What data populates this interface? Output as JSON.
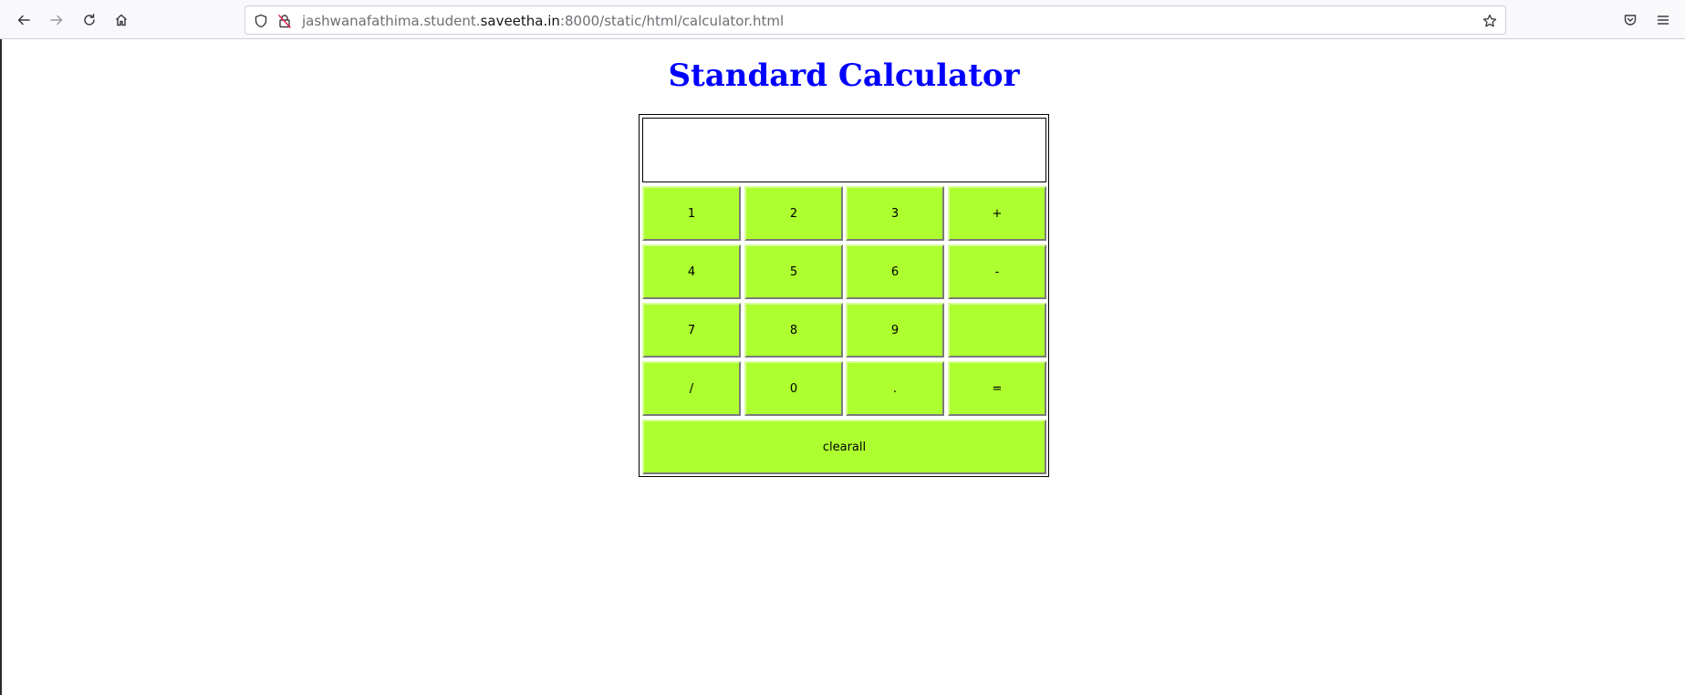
{
  "browser": {
    "url_prefix": "jashwanafathima.student.",
    "url_domain": "saveetha.in",
    "url_suffix": ":8000/static/html/calculator.html",
    "icons": [
      "back-arrow-icon",
      "forward-arrow-icon",
      "reload-icon",
      "home-icon",
      "shield-icon",
      "insecure-lock-icon",
      "star-icon",
      "pocket-icon",
      "hamburger-menu-icon"
    ]
  },
  "page": {
    "title": "Standard Calculator",
    "title_color": "#0000ff",
    "button_color": "#adff2f"
  },
  "calculator": {
    "display_value": "",
    "keys": {
      "k1": "1",
      "k2": "2",
      "k3": "3",
      "kplus": "+",
      "k4": "4",
      "k5": "5",
      "k6": "6",
      "kminus": "-",
      "k7": "7",
      "k8": "8",
      "k9": "9",
      "kblank": "",
      "kdiv": "/",
      "k0": "0",
      "kdot": ".",
      "keq": "=",
      "kclear": "clearall"
    }
  }
}
